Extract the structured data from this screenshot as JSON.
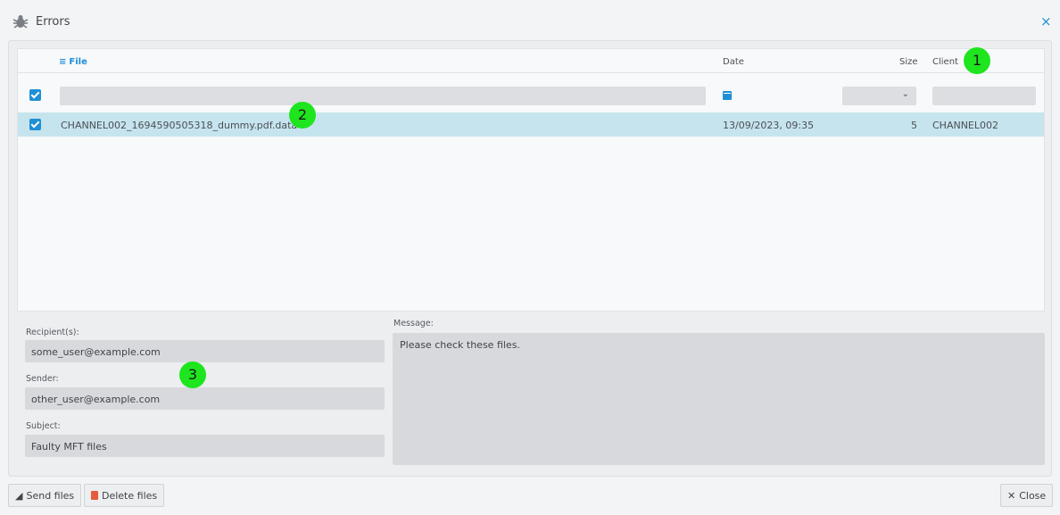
{
  "window": {
    "title": "Errors",
    "close_symbol": "×"
  },
  "grid": {
    "columns": {
      "file": "File",
      "date": "Date",
      "size": "Size",
      "client": "Client"
    },
    "file_menu_symbol": "≡",
    "size_filter_chevron": "⌄",
    "rows": [
      {
        "checked": true,
        "file": "CHANNEL002_1694590505318_dummy.pdf.data",
        "date": "13/09/2023, 09:35",
        "size": "5",
        "client": "CHANNEL002"
      }
    ]
  },
  "form": {
    "recipients_label": "Recipient(s):",
    "recipients_value": "some_user@example.com",
    "sender_label": "Sender:",
    "sender_value": "other_user@example.com",
    "subject_label": "Subject:",
    "subject_value": "Faulty MFT files",
    "message_label": "Message:",
    "message_value": "Please check these files."
  },
  "buttons": {
    "send_files": "Send files",
    "send_icon": "◢",
    "delete_files": "Delete files",
    "close": "Close",
    "close_icon": "✕"
  },
  "markers": [
    "1",
    "2",
    "3"
  ],
  "colors": {
    "accent": "#1f8fd6",
    "selected_row": "#c6e4ee",
    "marker": "#1ee51e",
    "delete_icon": "#e55b3c"
  }
}
